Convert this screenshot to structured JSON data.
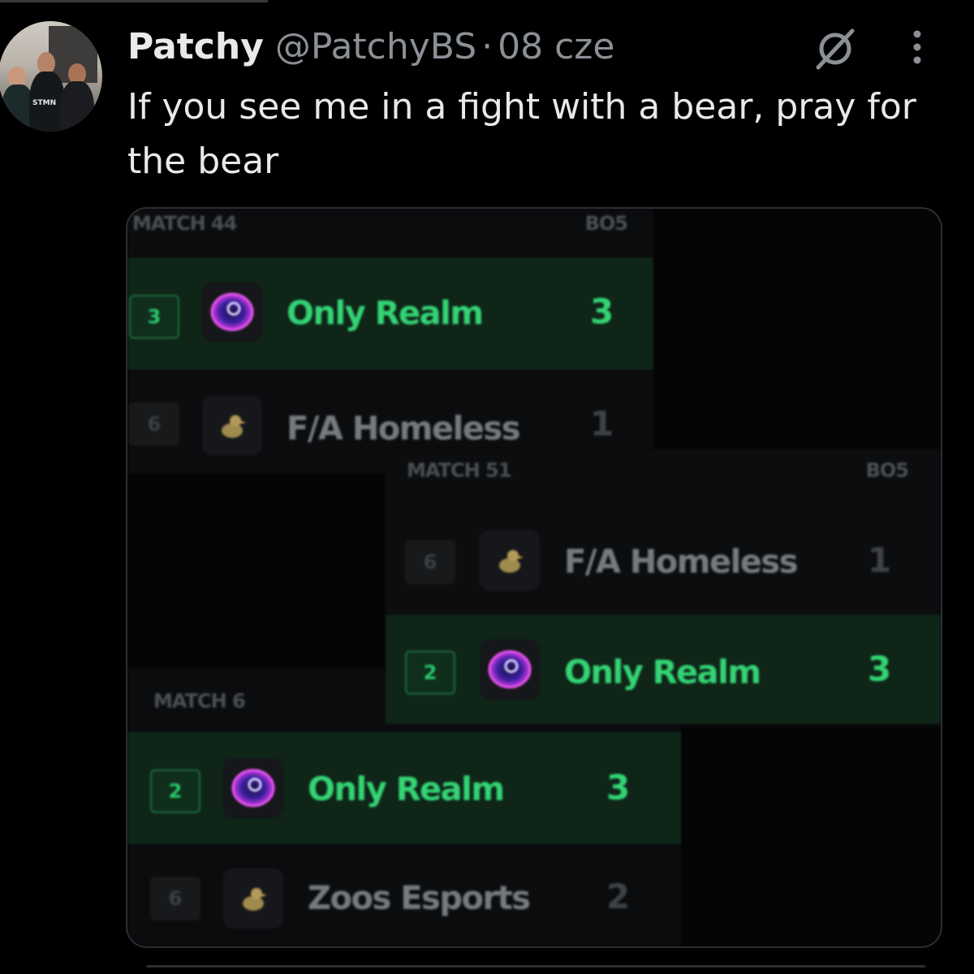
{
  "tweet": {
    "name": "Patchy",
    "handle": "@PatchyBS",
    "separator": "·",
    "date": "08 cze",
    "text": "If you see me in a fight with a bear, pray for the bear",
    "avatar_text": "STMN"
  },
  "icons": {
    "grok": "grok-slash-icon",
    "more": "more-vertical-icon"
  },
  "colors": {
    "win_green": "#34d474",
    "win_bg": "#0e2518",
    "muted": "#767a7f"
  },
  "matches": [
    {
      "label": "MATCH 44",
      "format": "BO5",
      "rows": [
        {
          "seed": "3",
          "team": "Only Realm",
          "score": "3",
          "result": "win",
          "logo": "only-realm-logo-icon"
        },
        {
          "seed": "6",
          "team": "F/A Homeless",
          "score": "1",
          "result": "lose",
          "logo": "duck-logo-icon"
        }
      ]
    },
    {
      "label": "MATCH 51",
      "format": "BO5",
      "rows": [
        {
          "seed": "6",
          "team": "F/A Homeless",
          "score": "1",
          "result": "lose",
          "logo": "duck-logo-icon"
        },
        {
          "seed": "2",
          "team": "Only Realm",
          "score": "3",
          "result": "win",
          "logo": "only-realm-logo-icon"
        }
      ]
    },
    {
      "label": "MATCH 6",
      "format": "",
      "rows": [
        {
          "seed": "2",
          "team": "Only Realm",
          "score": "3",
          "result": "win",
          "logo": "only-realm-logo-icon"
        },
        {
          "seed": "6",
          "team": "Zoos Esports",
          "score": "2",
          "result": "lose",
          "logo": "duck-logo-icon"
        }
      ]
    }
  ]
}
